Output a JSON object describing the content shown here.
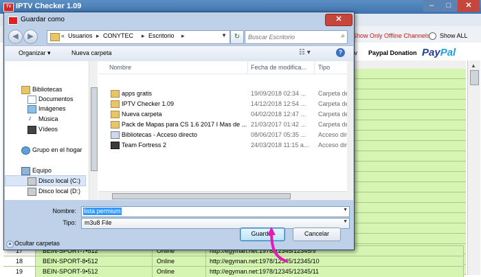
{
  "app": {
    "title": "IPTV Checker 1.09",
    "window_controls": [
      "–",
      "□",
      "✕"
    ],
    "show_offline_label": "Show Only Offline Channels",
    "show_all_label": "Show ALL",
    "tv_label": "tv",
    "paypal_donation": "Paypal Donation",
    "paypal_logo_part1": "Pay",
    "paypal_logo_part2": "Pal",
    "rows": [
      {
        "num": "17",
        "name": "BEIN-SPORT-7•512",
        "status": "Online",
        "url": "http://egyman.net:1978/12345/12345/9"
      },
      {
        "num": "18",
        "name": "BEIN-SPORT-8•512",
        "status": "Online",
        "url": "http://egyman.net:1978/12345/12345/10"
      },
      {
        "num": "19",
        "name": "BEIN-SPORT-9•512",
        "status": "Online",
        "url": "http://egyman.net:1978/12345/12345/11"
      }
    ]
  },
  "dialog": {
    "title": "Guardar como",
    "close": "✕",
    "breadcrumb": [
      "Usuarios",
      "CONYTEC",
      "Escritorio"
    ],
    "breadcrumb_prefix": "«",
    "search_placeholder": "Buscar Escritorio",
    "toolbar": {
      "organize": "Organizar ▾",
      "new_folder": "Nueva carpeta"
    },
    "nav": [
      {
        "label": "Bibliotecas",
        "icon": "library-icon"
      },
      {
        "label": "Documentos",
        "icon": "documents-icon"
      },
      {
        "label": "Imágenes",
        "icon": "pictures-icon"
      },
      {
        "label": "Música",
        "icon": "music-icon"
      },
      {
        "label": "Vídeos",
        "icon": "videos-icon"
      },
      {
        "label": "Grupo en el hogar",
        "icon": "homegroup-icon"
      },
      {
        "label": "Equipo",
        "icon": "computer-icon"
      },
      {
        "label": "Disco local (C:)",
        "icon": "disk-icon"
      },
      {
        "label": "Disco local (D:)",
        "icon": "disk-icon"
      }
    ],
    "columns": {
      "name": "Nombre",
      "date": "Fecha de modifica...",
      "type": "Tipo"
    },
    "files": [
      {
        "name": "apps gratis",
        "date": "19/09/2018 02:34 ...",
        "type": "Carpeta de a"
      },
      {
        "name": "IPTV Checker 1.09",
        "date": "14/12/2018 12:54 ...",
        "type": "Carpeta de a"
      },
      {
        "name": "Nueva carpeta",
        "date": "04/02/2018 12:47 ...",
        "type": "Carpeta de a"
      },
      {
        "name": "Pack de Mapas para CS 1.6 2017 I Mas de ...",
        "date": "21/03/2017 01:42 ...",
        "type": "Carpeta de a"
      },
      {
        "name": "Bibliotecas - Acceso directo",
        "date": "08/06/2017 05:35 ...",
        "type": "Acceso direct"
      },
      {
        "name": "Team Fortress 2",
        "date": "24/03/2018 11:15 a...",
        "type": "Acceso direct"
      }
    ],
    "filename_label": "Nombre:",
    "filename_value": "lista permium",
    "filetype_label": "Tipo:",
    "filetype_value": "m3u8 File",
    "hide_folders": "Ocultar carpetas",
    "save_button": "Guardar",
    "cancel_button": "Cancelar"
  },
  "colors": {
    "accent": "#3c7fb1",
    "grid_green": "#d7f5b2",
    "pointer": "#e21bb5",
    "offline_red": "#c01818"
  }
}
